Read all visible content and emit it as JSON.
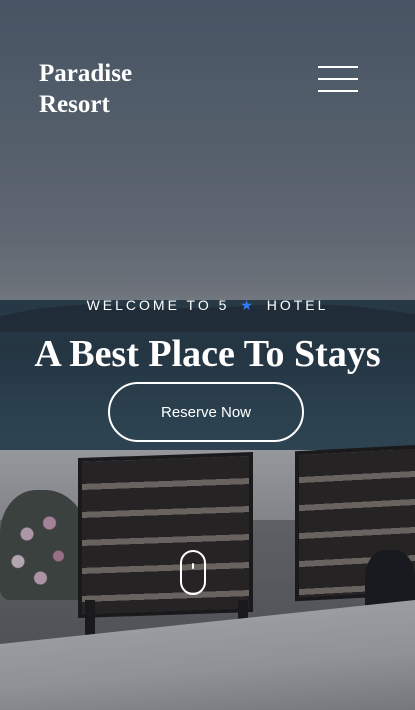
{
  "header": {
    "logo_line1": "Paradise",
    "logo_line2": "Resort",
    "menu_icon": "hamburger-menu-icon"
  },
  "hero": {
    "welcome_before": "WELCOME TO 5",
    "welcome_icon": "star-icon",
    "welcome_after": "HOTEL",
    "headline": "A Best Place To Stays",
    "cta_label": "Reserve Now",
    "scroll_icon": "mouse-scroll-icon"
  },
  "colors": {
    "accent_star": "#2f7cf6",
    "text": "#ffffff"
  }
}
